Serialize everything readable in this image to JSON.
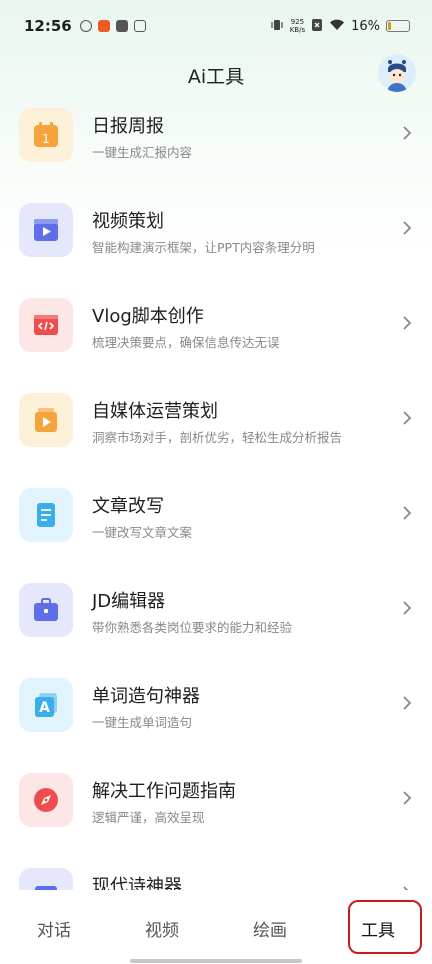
{
  "status_bar": {
    "time": "12:56",
    "net_speed_value": "925",
    "net_speed_unit": "KB/s",
    "battery_pct": "16%",
    "battery_level": 0.16
  },
  "header": {
    "title": "Ai工具"
  },
  "tools": [
    {
      "title": "日报周报",
      "desc": "一键生成汇报内容",
      "icon": "calendar-icon",
      "bg": "#fdf0d8",
      "fg": "#f5a43b"
    },
    {
      "title": "视频策划",
      "desc": "智能构建演示框架，让PPT内容条理分明",
      "icon": "video-clapper-icon",
      "bg": "#e5e8fb",
      "fg": "#5d6ee8"
    },
    {
      "title": "Vlog脚本创作",
      "desc": "梳理决策要点，确保信息传达无误",
      "icon": "code-script-icon",
      "bg": "#fde6e6",
      "fg": "#ef4d4d"
    },
    {
      "title": "自媒体运营策划",
      "desc": "洞察市场对手，剖析优劣，轻松生成分析报告",
      "icon": "media-play-icon",
      "bg": "#fdf0d8",
      "fg": "#f5a43b"
    },
    {
      "title": "文章改写",
      "desc": "一键改写文章文案",
      "icon": "document-icon",
      "bg": "#e1f3fd",
      "fg": "#3aaeea"
    },
    {
      "title": "JD编辑器",
      "desc": "带你熟悉各类岗位要求的能力和经验",
      "icon": "briefcase-icon",
      "bg": "#e5e8fb",
      "fg": "#5d6ee8"
    },
    {
      "title": "单词造句神器",
      "desc": "一键生成单词造句",
      "icon": "letter-a-icon",
      "bg": "#e1f3fd",
      "fg": "#3aaeea"
    },
    {
      "title": "解决工作问题指南",
      "desc": "逻辑严谨，高效呈现",
      "icon": "compass-icon",
      "bg": "#fde6e6",
      "fg": "#ef4d4d"
    },
    {
      "title": "现代诗神器",
      "desc": "",
      "icon": "book-icon",
      "bg": "#e5e8fb",
      "fg": "#5d6ee8"
    }
  ],
  "tabs": [
    {
      "label": "对话"
    },
    {
      "label": "视频"
    },
    {
      "label": "绘画"
    },
    {
      "label": "工具"
    }
  ],
  "colors": {
    "accent_highlight": "#cc1a1a"
  }
}
